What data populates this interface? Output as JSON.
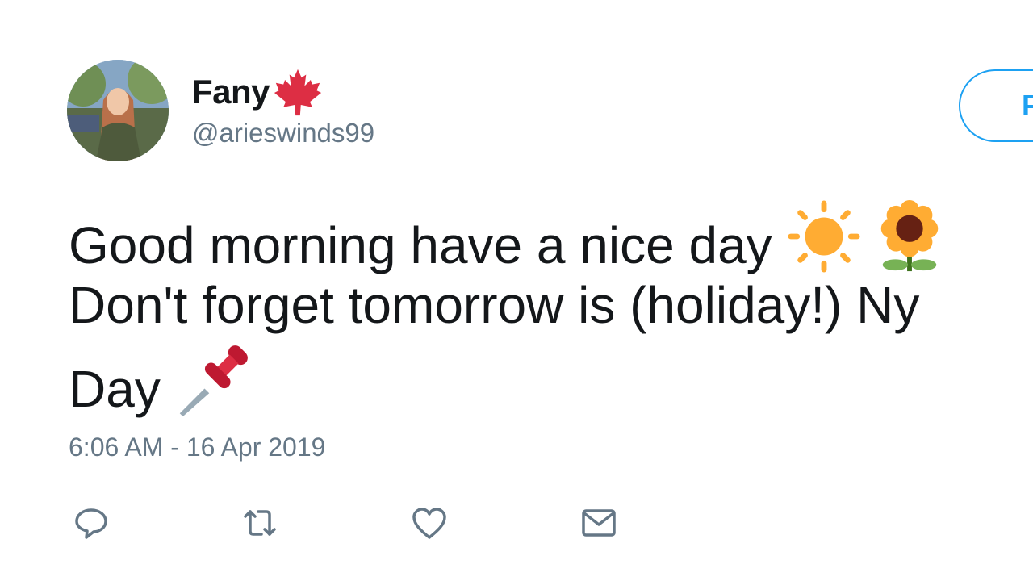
{
  "tweet": {
    "author": {
      "display_name": "Fany",
      "handle": "@arieswinds99",
      "flag_icon": "maple-leaf-icon"
    },
    "follow_label": "Follow",
    "text_lines": [
      "Good morning have a nice day ",
      "Don't forget tomorrow is (holiday!) Ny",
      "Day "
    ],
    "timestamp": "6:06 AM - 16 Apr 2019",
    "actions": [
      "reply-icon",
      "retweet-icon",
      "like-icon",
      "direct-message-icon"
    ]
  },
  "colors": {
    "accent": "#1da1f2",
    "text": "#14171a",
    "secondary": "#657786",
    "maple": "#dd2e44"
  }
}
